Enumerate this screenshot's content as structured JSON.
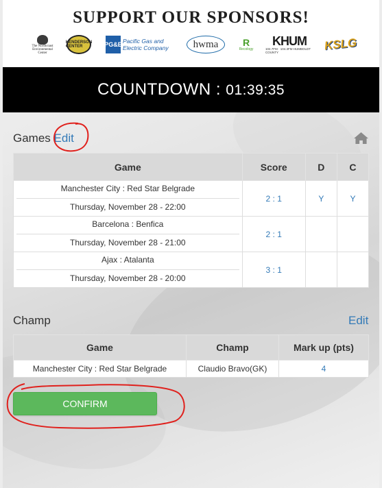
{
  "sponsors": {
    "title": "SUPPORT OUR SPONSORS!",
    "logos": [
      {
        "name": "northcoast-environmental-center",
        "text": "The Northcoast Environmental Center"
      },
      {
        "name": "henderson-center",
        "text": "HENDERSON CENTER"
      },
      {
        "name": "pge",
        "short": "PG&E",
        "text": "Pacific Gas and Electric Company"
      },
      {
        "name": "hwma",
        "text": "hwma"
      },
      {
        "name": "recology",
        "short": "R",
        "text": "Recology"
      },
      {
        "name": "khum",
        "text": "KHUM",
        "sub": "104.7FM · 104.3FM  HUMBOLDT COUNTY"
      },
      {
        "name": "kslg",
        "text": "KSLG"
      }
    ]
  },
  "countdown": {
    "label": "COUNTDOWN",
    "separator": " : ",
    "time": "01:39:35"
  },
  "games": {
    "title": "Games",
    "edit_label": "Edit",
    "columns": [
      "Game",
      "Score",
      "D",
      "C"
    ],
    "rows": [
      {
        "match": "Manchester City : Red Star Belgrade",
        "date": "Thursday, November 28 - 22:00",
        "score": "2 : 1",
        "d": "Y",
        "c": "Y"
      },
      {
        "match": "Barcelona : Benfica",
        "date": "Thursday, November 28 - 21:00",
        "score": "2 : 1",
        "d": "",
        "c": ""
      },
      {
        "match": "Ajax : Atalanta",
        "date": "Thursday, November 28 - 20:00",
        "score": "3 : 1",
        "d": "",
        "c": ""
      }
    ]
  },
  "champ": {
    "title": "Champ",
    "edit_label": "Edit",
    "columns": [
      "Game",
      "Champ",
      "Mark up (pts)"
    ],
    "rows": [
      {
        "game": "Manchester City : Red Star Belgrade",
        "champ": "Claudio Bravo(GK)",
        "markup": "4"
      }
    ]
  },
  "confirm_label": "CONFIRM",
  "colors": {
    "link": "#337ab7",
    "confirm": "#5cb85c",
    "annotation": "#e0201c",
    "countdown_bg": "#000000"
  },
  "icons": {
    "home": "home-icon"
  }
}
